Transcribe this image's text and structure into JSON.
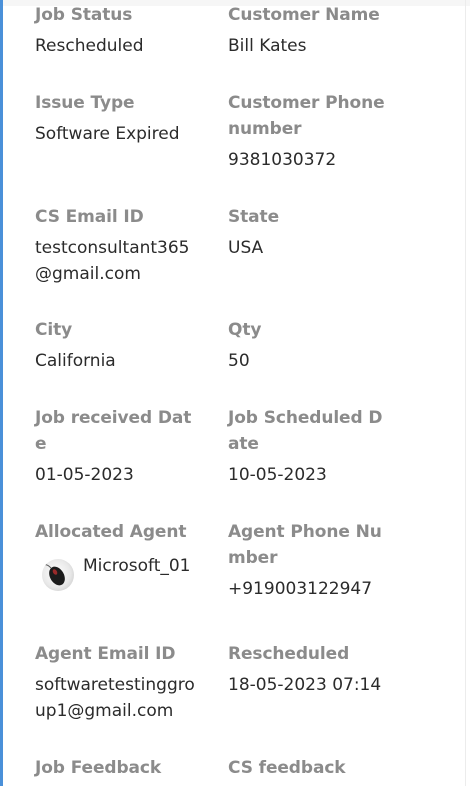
{
  "fields": {
    "job_status": {
      "label": "Job Status",
      "value": "Rescheduled"
    },
    "customer_name": {
      "label": "Customer Name",
      "value": "Bill Kates"
    },
    "issue_type": {
      "label": "Issue Type",
      "value": "Software Expired"
    },
    "customer_phone": {
      "label": "Customer Phone number",
      "value": "9381030372"
    },
    "cs_email": {
      "label": "CS Email ID",
      "value": "testconsultant365@gmail.com"
    },
    "state": {
      "label": "State",
      "value": "USA"
    },
    "city": {
      "label": "City",
      "value": "California"
    },
    "qty": {
      "label": "Qty",
      "value": "50"
    },
    "job_received_date": {
      "label": "Job received Date",
      "value": "01-05-2023"
    },
    "job_scheduled_date": {
      "label": "Job Scheduled Date",
      "value": "10-05-2023"
    },
    "allocated_agent": {
      "label": "Allocated Agent",
      "value": "Microsoft_01",
      "avatar_icon": "computer-mouse-icon"
    },
    "agent_phone": {
      "label": "Agent Phone Number",
      "value": "+919003122947"
    },
    "agent_email": {
      "label": "Agent Email ID",
      "value": "softwaretestinggroup1@gmail.com"
    },
    "rescheduled": {
      "label": "Rescheduled",
      "value": "18-05-2023 07:14"
    },
    "job_feedback": {
      "label": "Job Feedback"
    },
    "cs_feedback": {
      "label": "CS feedback"
    }
  },
  "colors": {
    "accent_border": "#4a90d9",
    "label": "#8b8b8b",
    "value": "#2b2b2b"
  }
}
